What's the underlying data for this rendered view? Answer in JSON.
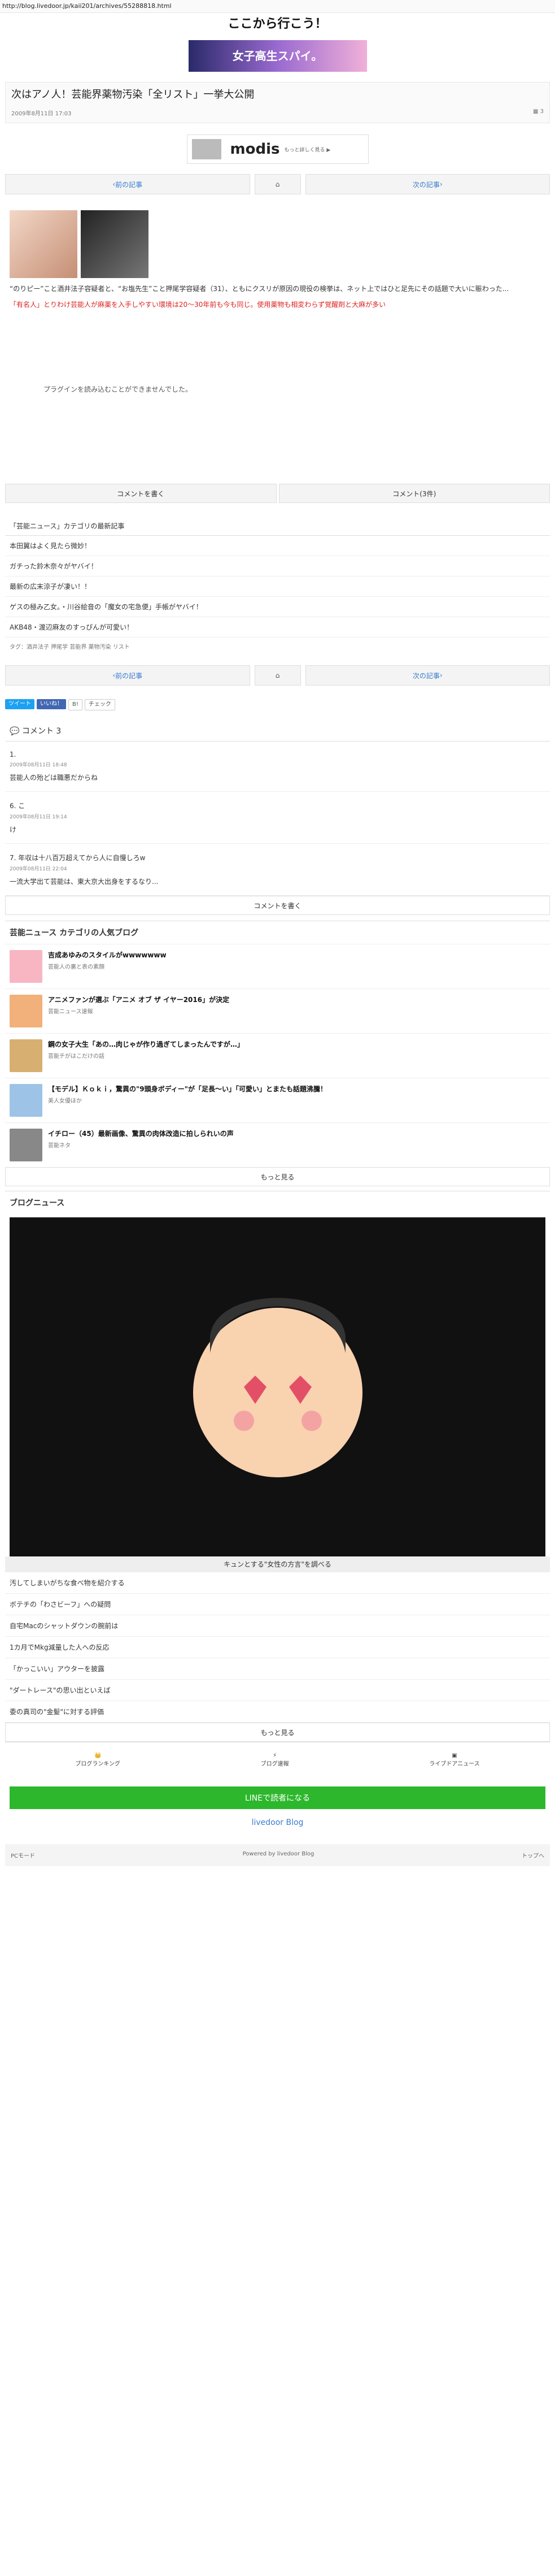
{
  "url": "http://blog.livedoor.jp/kaii201/archives/55288818.html",
  "site_title": "ここから行こう！",
  "top_banner": "女子高生スパイ。",
  "article": {
    "title": "次はアノ人！芸能界薬物汚染「全リスト」一挙大公開",
    "date": "2009年8月11日 17:03",
    "comments": "3",
    "intro": "“のりピー”こと酒井法子容疑者と、“お塩先生”こと押尾学容疑者（31）、ともにクスリが原因の現役の検挙は、ネット上ではひと足先にその話題で大いに賑わった...",
    "red_text": "「有名人」とりわけ芸能人が麻薬を入手しやすい環境は20～30年前も今も同じ。使用薬物も相変わらず覚醒剤と大麻が多い",
    "plugin_msg": "プラグインを読み込むことができませんでした。"
  },
  "nav": {
    "prev": "前の記事",
    "next": "次の記事"
  },
  "comment_buttons": {
    "write": "コメントを書く",
    "count": "コメント(3件)"
  },
  "category": {
    "head": "「芸能ニュース」カテゴリの最新記事",
    "items": [
      "本田翼はよく見たら微妙！",
      "ガチった鈴木奈々がヤバイ！",
      "最新の広末涼子が凄い！！",
      "ゲスの極み乙女。・川谷絵音の「魔女の宅急便」手帳がヤバイ！",
      "AKB48・渡辺麻友のすっぴんが可愛い！"
    ],
    "tags": "タグ：酒井法子 押尾学 芸能界 薬物汚染 リスト"
  },
  "social": {
    "tweet": "ツイート",
    "like": "いいね！",
    "b": "B!",
    "check": "チェック"
  },
  "comments": {
    "head": "コメント",
    "count": "3",
    "list": [
      {
        "n": "1.",
        "date": "2009年08月11日 18:48",
        "body": "芸能人の殆どは職悪だからね"
      },
      {
        "n": "6. こ",
        "date": "2009年08月11日 19:14",
        "body": "け"
      },
      {
        "n": "7. 年収は十八百万超えてから人に自慢しろw",
        "date": "2009年08月11日 22:04",
        "body": "一流大学出て芸能は、東大京大出身をするなり..."
      }
    ],
    "more": "コメントを書く"
  },
  "popular": {
    "head": "芸能ニュース カテゴリの人気ブログ",
    "items": [
      {
        "title": "吉成あゆみのスタイルがwwwwwww",
        "sub": "芸能人の裏と表の素顔"
      },
      {
        "title": "アニメファンが選ぶ「アニメ オブ ザ イヤー2016」が決定",
        "sub": "芸能ニュース速報"
      },
      {
        "title": "鋼の女子大生「あの…肉じゃが作り過ぎてしまったんですが…」",
        "sub": "芸能チがはこだけの話"
      },
      {
        "title": "【モデル】Ｋｏｋｉ，驚異の\"9頭身ボディー\"が「足長～い」「可愛い」とまたも話題沸騰！",
        "sub": "美人女優ほか"
      },
      {
        "title": "イチロー（45）最新画像、驚異の肉体改造に拍しられいの声",
        "sub": "芸能ネタ"
      }
    ],
    "more": "もっと見る"
  },
  "blog_news": {
    "head": "ブログニュース",
    "caption": "キュンとする\"女性の方言\"を調べる",
    "items": [
      "汚してしまいがちな食べ物を紹介する",
      "ボテチの「わさビーフ」への疑問",
      "自宅Macのシャットダウンの腕前は",
      "1カ月でMkg減量した人への反応",
      "「かっこいい」アウターを披露",
      "\"ダートレース\"の思い出といえば",
      "委の真司の\"金髪\"に対する評価"
    ],
    "more": "もっと見る"
  },
  "footer": {
    "nav": [
      "ブログランキング",
      "ブログ速報",
      "ライブドアニュース"
    ],
    "line": "LINEで読者になる",
    "brand": "livedoor Blog",
    "left": "PCモード",
    "center": "Powered by livedoor Blog",
    "right": "トップへ"
  }
}
